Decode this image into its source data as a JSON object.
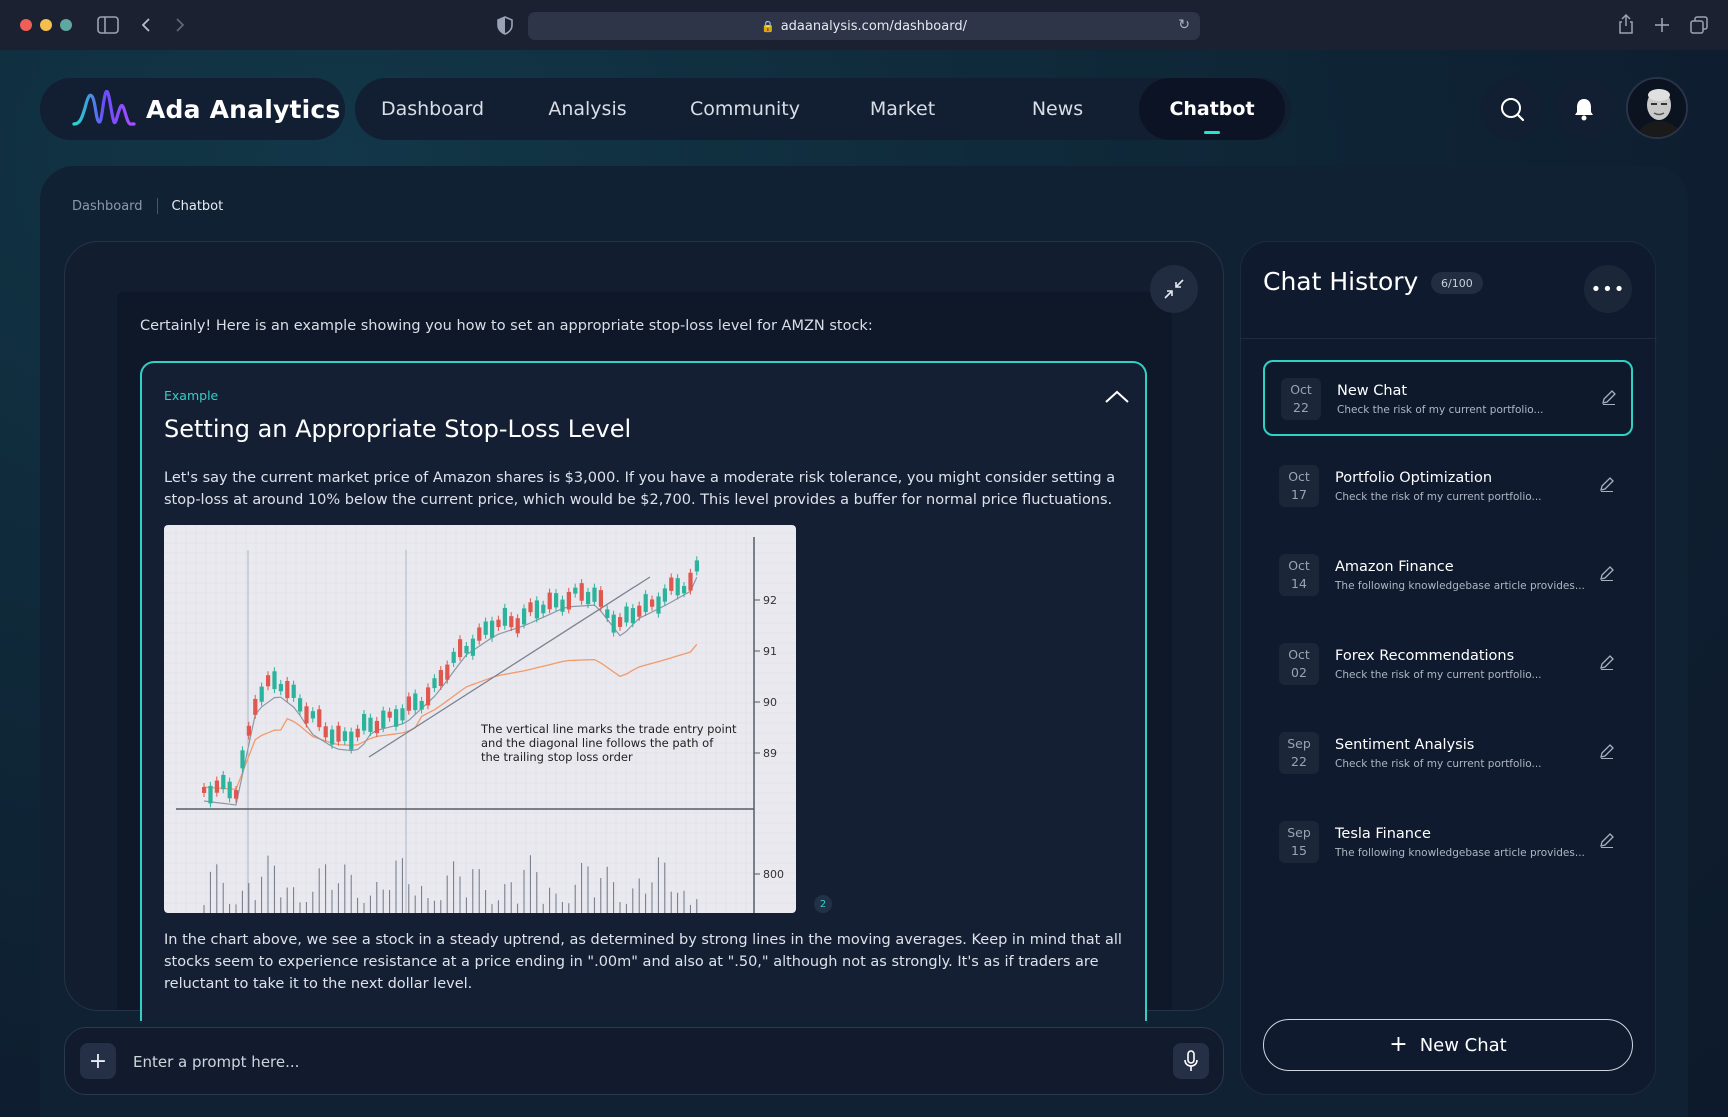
{
  "browser": {
    "url": "adaanalysis.com/dashboard/",
    "traffic_lights": [
      "#ed5f57",
      "#f4bf4f",
      "#5fa8a0"
    ]
  },
  "brand": {
    "name": "Ada Analytics"
  },
  "nav": {
    "items": [
      {
        "label": "Dashboard",
        "active": false
      },
      {
        "label": "Analysis",
        "active": false
      },
      {
        "label": "Community",
        "active": false
      },
      {
        "label": "Market",
        "active": false
      },
      {
        "label": "News",
        "active": false
      },
      {
        "label": "Chatbot",
        "active": true
      }
    ],
    "icons": [
      "search-icon",
      "bell-icon"
    ]
  },
  "breadcrumb": {
    "items": [
      "Dashboard",
      "Chatbot"
    ]
  },
  "chat": {
    "intro": "Certainly! Here is an example showing you how to set an appropriate stop-loss level for AMZN stock:",
    "example": {
      "label": "Example",
      "title": "Setting an Appropriate Stop-Loss Level",
      "paragraph1": "Let's say the current market price of Amazon shares is $3,000. If you have a moderate risk tolerance, you might consider setting a stop-loss at around 10% below the current price, which would be $2,700. This level provides a buffer for normal price fluctuations.",
      "chart_annotation": [
        "The vertical line marks the trade entry point",
        "and the diagonal line follows the path of",
        "the trailing stop loss order"
      ],
      "price_ticks": [
        "92",
        "91",
        "90",
        "89"
      ],
      "volume_tick": "800",
      "citation_badge": "2",
      "paragraph2": "In the chart above, we see a stock in a steady uptrend, as determined by strong lines in the moving averages. Keep in mind that all stocks seem to experience resistance at a price ending in \".00m\" and also at \".50,\" although not as strongly. It's as if traders are reluctant to take it to the next dollar level."
    }
  },
  "prompt": {
    "placeholder": "Enter a prompt here..."
  },
  "history": {
    "title": "Chat History",
    "count": "6/100",
    "items": [
      {
        "month": "Oct",
        "day": "22",
        "title": "New Chat",
        "subtitle": "Check the risk of my current portfolio...",
        "active": true
      },
      {
        "month": "Oct",
        "day": "17",
        "title": "Portfolio Optimization",
        "subtitle": "Check the risk of my current portfolio...",
        "active": false
      },
      {
        "month": "Oct",
        "day": "14",
        "title": "Amazon Finance",
        "subtitle": "The following knowledgebase article provides...",
        "active": false
      },
      {
        "month": "Oct",
        "day": "02",
        "title": "Forex Recommendations",
        "subtitle": "Check the risk of my current portfolio...",
        "active": false
      },
      {
        "month": "Sep",
        "day": "22",
        "title": "Sentiment Analysis",
        "subtitle": "Check the risk of my current portfolio...",
        "active": false
      },
      {
        "month": "Sep",
        "day": "15",
        "title": "Tesla Finance",
        "subtitle": "The following knowledgebase article provides...",
        "active": false
      }
    ],
    "new_chat_label": "New Chat"
  },
  "colors": {
    "accent": "#2fd1c5",
    "up": "#2bb39b",
    "down": "#e0574f",
    "ma_fast": "#9aa3b4",
    "ma_slow": "#f39a6b"
  }
}
